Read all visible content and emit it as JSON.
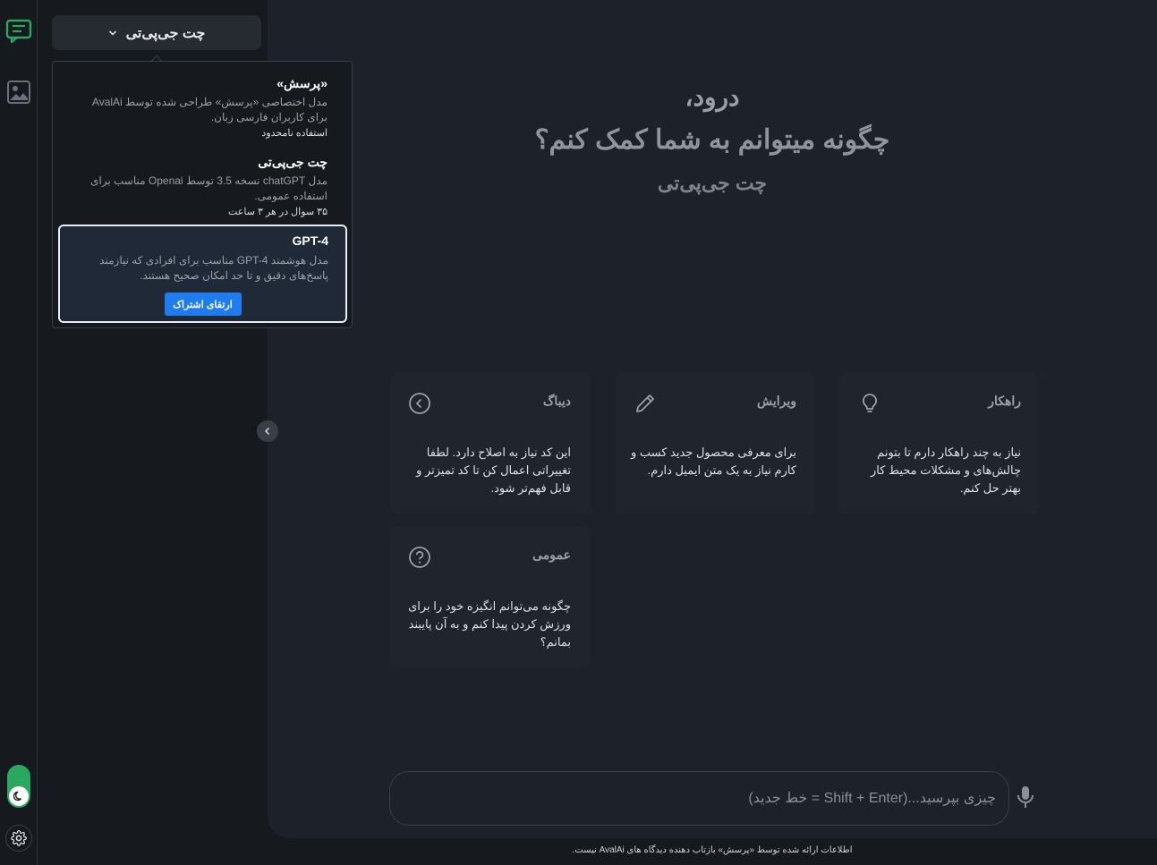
{
  "colors": {
    "accent": "#1f7cf0",
    "brand_green": "#2aa860",
    "background": "#16191e",
    "panel": "#1d2129"
  },
  "rail": {
    "chat_icon": "chat-bubble-icon",
    "image_icon": "image-icon",
    "theme_icon": "moon-icon",
    "settings_icon": "gear-icon"
  },
  "model_selector": {
    "label": "چت جی‌پی‌تی",
    "icon": "chevron-down-icon"
  },
  "dropdown": {
    "items": [
      {
        "title": "«پرسش»",
        "desc": "مدل اختصاصی «پرسش» طراحی شده توسط AvalAi برای کاربران فارسی زبان.",
        "note": "استفاده نامحدود"
      },
      {
        "title": "چت جی‌پی‌تی",
        "desc": "مدل chatGPT نسخه 3.5 توسط Openai مناسب برای استفاده عمومی.",
        "note": "۳۵ سوال در هر ۳ ساعت"
      },
      {
        "title": "GPT-4",
        "desc": "مدل هوشمند GPT-4 مناسب برای افرادی که نیازمند پاسخ‌های دقیق و تا حد امکان صحیح هستند.",
        "button": "ارتقای اشتراک"
      }
    ]
  },
  "greeting": {
    "line1": "درود،",
    "line2": "چگونه میتوانم به شما کمک کنم؟",
    "line3": "چت جی‌پی‌تی"
  },
  "cards": [
    {
      "title": "راهکار",
      "icon": "lightbulb-icon",
      "text": "نیاز به چند راهکار دارم تا بتونم چالش‌های و مشکلات محیط کار بهتر حل کنم."
    },
    {
      "title": "ویرایش",
      "icon": "pencil-icon",
      "text": "برای معرفی محصول جدید کسب و کارم نیاز به یک متن ایمیل دارم."
    },
    {
      "title": "دیباگ",
      "icon": "code-icon",
      "text": "این کد نیاز به اصلاح دارد. لطفا تغییراتی اعمال کن تا کد تمیزتر و قابل فهم‌تر شود."
    },
    {
      "title": "عمومی",
      "icon": "question-icon",
      "text": "چگونه می‌توانم انگیزه خود را برای ورزش کردن پیدا کنم و به آن پایبند بمانم؟"
    }
  ],
  "input": {
    "placeholder": "چیزی بپرسید...(Shift + Enter = خط جدید)",
    "mic_icon": "microphone-icon"
  },
  "footer": {
    "text": "اطلاعات ارائه شده توسط «پرسش» بازتاب دهنده دیدگاه های AvalAi نیست."
  }
}
